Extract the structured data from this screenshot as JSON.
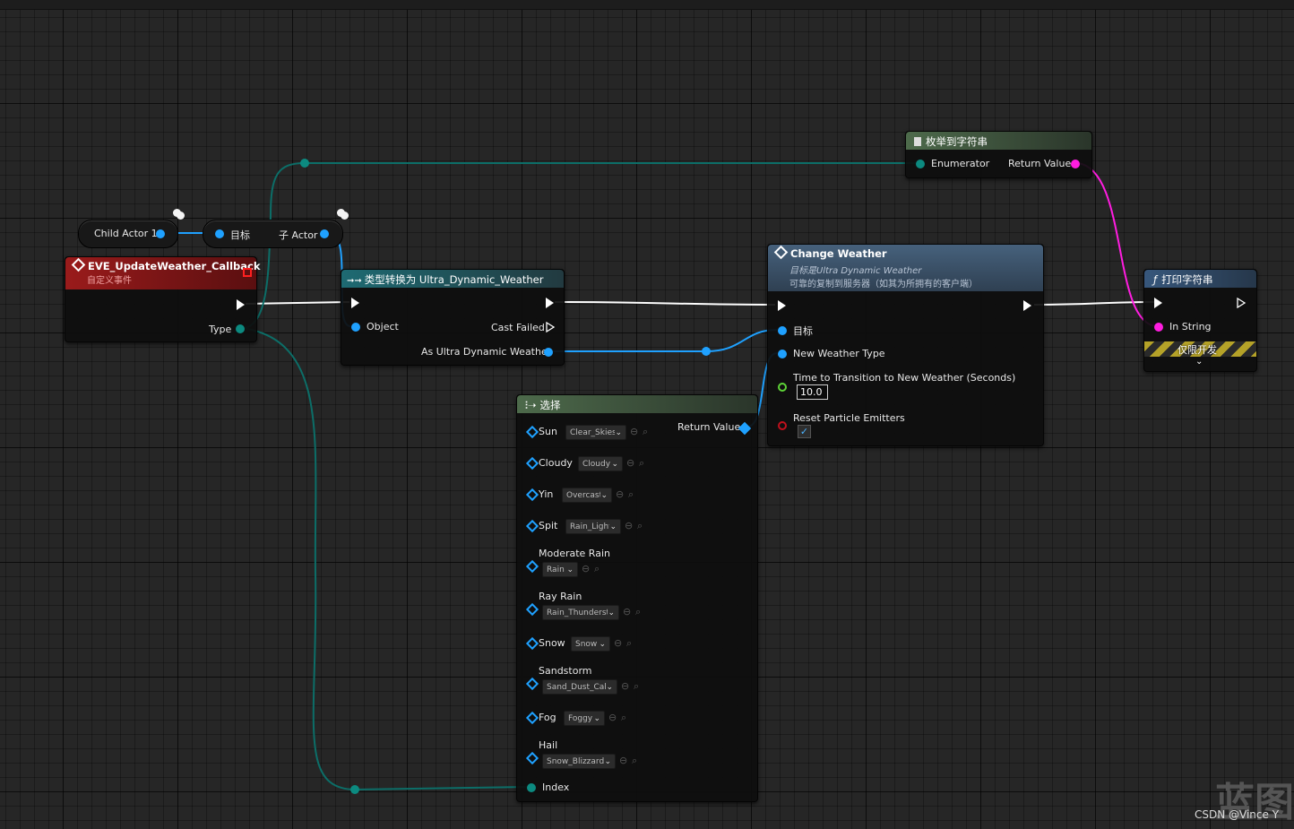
{
  "nodes": {
    "child_actor": {
      "label": "Child Actor 1"
    },
    "get_child": {
      "target_label": "目标",
      "out_label": "子 Actor"
    },
    "event": {
      "title": "EVE_UpdateWeather_Callback",
      "subtitle": "自定义事件",
      "type_pin": "Type"
    },
    "cast": {
      "title": "类型转换为 Ultra_Dynamic_Weather",
      "object_pin": "Object",
      "cast_failed_pin": "Cast Failed",
      "as_pin": "As Ultra Dynamic Weather"
    },
    "enum_to_string": {
      "title": "枚举到字符串",
      "enumerator_pin": "Enumerator",
      "return_pin": "Return Value"
    },
    "change_weather": {
      "title": "Change Weather",
      "subtitle1": "目标是Ultra Dynamic Weather",
      "subtitle2": "可靠的复制到服务器（如其为所拥有的客户端）",
      "target_pin": "目标",
      "new_weather_pin": "New Weather Type",
      "time_pin": "Time to Transition to New Weather (Seconds)",
      "time_value": "10.0",
      "reset_pin": "Reset Particle Emitters",
      "reset_checked": true
    },
    "print_string": {
      "title": "打印字符串",
      "in_string_pin": "In String",
      "dev_only": "仅限开发"
    },
    "select": {
      "title": "选择",
      "return_pin": "Return Value",
      "index_pin": "Index",
      "options": [
        {
          "label": "Sun",
          "value": "Clear_Skies"
        },
        {
          "label": "Cloudy",
          "value": "Cloudy"
        },
        {
          "label": "Yin",
          "value": "Overcast"
        },
        {
          "label": "Spit",
          "value": "Rain_Light"
        },
        {
          "label": "Moderate Rain",
          "value": "Rain"
        },
        {
          "label": "Ray Rain",
          "value": "Rain_Thunderstc"
        },
        {
          "label": "Snow",
          "value": "Snow"
        },
        {
          "label": "Sandstorm",
          "value": "Sand_Dust_Caln"
        },
        {
          "label": "Fog",
          "value": "Foggy"
        },
        {
          "label": "Hail",
          "value": "Snow_Blizzard"
        }
      ]
    }
  },
  "watermark": "CSDN @Vince Y",
  "watermark_char": "蓝图",
  "colors": {
    "exec": "#ffffff",
    "object_pin": "#1fa1ff",
    "enum_pin": "#0c8a80",
    "string_pin": "#ff1de0",
    "float_pin": "#5ed437",
    "bool_pin": "#c0101c",
    "event_header": "#8c1414",
    "function_header": "#2d4f74",
    "cast_header": "#1c5a63",
    "pure_header": "#3f5a3d"
  },
  "icons": [
    "event-diamond-icon",
    "cast-arrow-icon",
    "function-icon",
    "document-icon",
    "select-icon",
    "dropdown-chevron-icon",
    "reset-arrow-icon",
    "magnifier-icon",
    "checkbox-check-icon",
    "expand-chevron-icon"
  ]
}
